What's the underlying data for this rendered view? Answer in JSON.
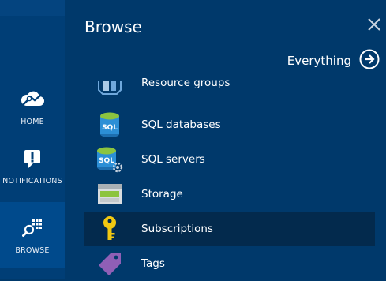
{
  "nav": {
    "items": [
      {
        "label": "HOME",
        "icon": "cloud-icon"
      },
      {
        "label": "NOTIFICATIONS",
        "icon": "alert-icon"
      },
      {
        "label": "BROWSE",
        "icon": "browse-icon",
        "active": true
      }
    ]
  },
  "blade": {
    "title": "Browse",
    "close_icon": "close-icon",
    "everything_label": "Everything",
    "everything_icon": "arrow-right-circle-icon",
    "items": [
      {
        "label": "Resource groups",
        "icon": "resource-groups-icon"
      },
      {
        "label": "SQL databases",
        "icon": "sql-database-icon"
      },
      {
        "label": "SQL servers",
        "icon": "sql-server-icon"
      },
      {
        "label": "Storage",
        "icon": "storage-icon"
      },
      {
        "label": "Subscriptions",
        "icon": "key-icon",
        "selected": true
      },
      {
        "label": "Tags",
        "icon": "tag-icon"
      }
    ]
  },
  "colors": {
    "background": "#00396b",
    "rail": "#003e76",
    "active_nav": "#004a8c",
    "selected_row": "#032a4d",
    "sql_blue": "#2c8fd6",
    "storage_green": "#8cc43f",
    "key_yellow": "#f2c811",
    "tag_purple": "#8f5fb6"
  }
}
